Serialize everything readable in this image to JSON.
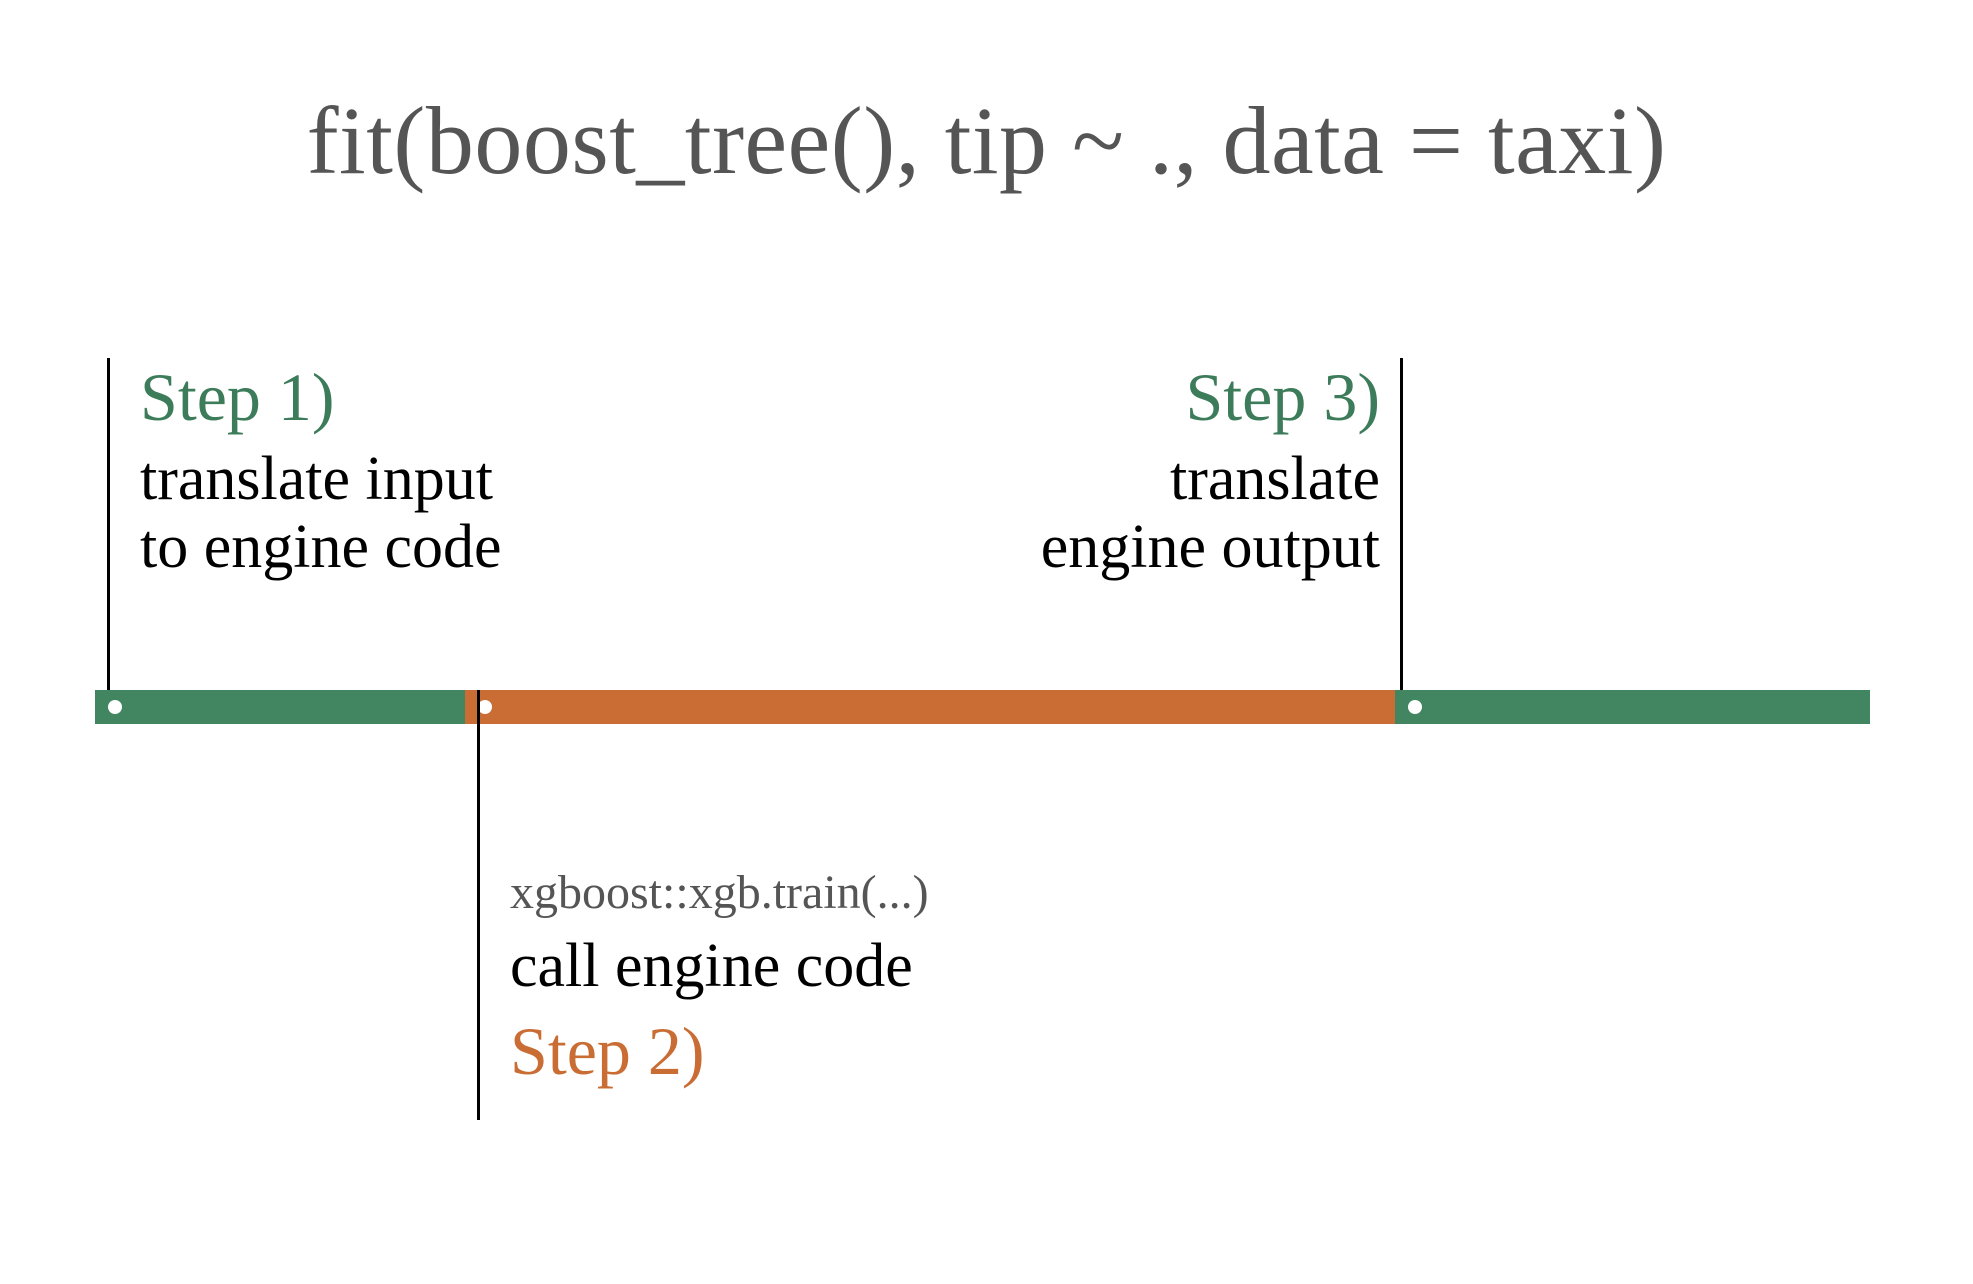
{
  "title": "fit(boost_tree(), tip ~ ., data = taxi)",
  "colors": {
    "green": "#418561",
    "orange": "#c96d34",
    "title": "#555555"
  },
  "step1": {
    "label": "Step 1)",
    "desc_line1": "translate input",
    "desc_line2": "to engine code"
  },
  "step2": {
    "label": "Step 2)",
    "code": "xgboost::xgb.train(...)",
    "desc": "call engine code"
  },
  "step3": {
    "label": "Step 3)",
    "desc_line1": "translate",
    "desc_line2": "engine output"
  }
}
